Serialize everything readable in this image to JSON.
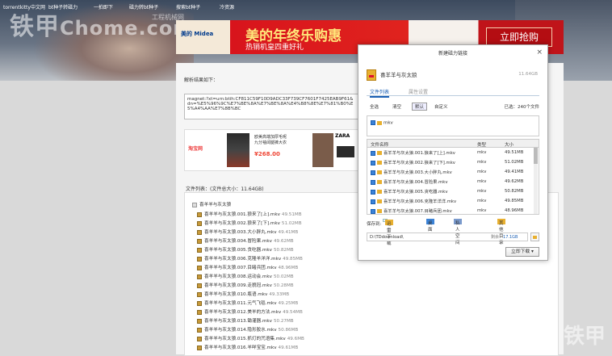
{
  "nav": [
    "torrentkitty中文网",
    "bt种子转磁力",
    "一拍即下",
    "磁力转bt种子",
    "搜索bt种子",
    "冷资源"
  ],
  "watermark": {
    "main": "铁甲",
    "url": "工程机械网",
    "site": "Chome.com",
    "bottom_right": "铁甲"
  },
  "banner": {
    "brand": "美的 Midea",
    "headline": "美的年终乐购惠",
    "subline": "热销机皇四重好礼",
    "cta": "立即抢购"
  },
  "page": {
    "result_label": "解析结果如下：",
    "magnet": "magnet:?xt=urn:btih:CF811C59F10D9ADC33F739CF7601F7425EAB9F61&dn=%E5%96%9C%E7%BE%8A%E7%BE%8A%E4%B8%8E%E7%81%B0%E5%A4%AA%E7%8B%BC",
    "file_list_label": "文件列表：(文件总大小：11.64GB)"
  },
  "ad": {
    "shop": "淘宝网",
    "desc": "欧美高端加厚毛呢\n九分袖阔腿裤大衣",
    "price": "¥268.00",
    "brand": "ZARA",
    "tag2": "cor"
  },
  "tree": {
    "root": "喜羊羊与灰太狼",
    "items": [
      {
        "name": "喜羊羊与灰太狼.001.狼来了[上].mkv",
        "size": "49.51MB"
      },
      {
        "name": "喜羊羊与灰太狼.002.狼来了[下].mkv",
        "size": "51.02MB"
      },
      {
        "name": "喜羊羊与灰太狼.003.大小胖丸.mkv",
        "size": "49.41MB"
      },
      {
        "name": "喜羊羊与灰太狼.004.冒险果.mkv",
        "size": "49.62MB"
      },
      {
        "name": "喜羊羊与灰太狼.005.贪吃器.mkv",
        "size": "50.82MB"
      },
      {
        "name": "喜羊羊与灰太狼.006.克隆羊洋洋.mkv",
        "size": "49.85MB"
      },
      {
        "name": "喜羊羊与灰太狼.007.目睹兵团.mkv",
        "size": "48.96MB"
      },
      {
        "name": "喜羊羊与灰太狼.008.运动会.mkv",
        "size": "50.02MB"
      },
      {
        "name": "喜羊羊与灰太狼.009.走貌冠.mkv",
        "size": "50.28MB"
      },
      {
        "name": "喜羊羊与灰太狼.010.瓶语.mkv",
        "size": "49.33MB"
      },
      {
        "name": "喜羊羊与灰太狼.011.元气飞毯.mkv",
        "size": "49.25MB"
      },
      {
        "name": "喜羊羊与灰太狼.012.美羊的方法.mkv",
        "size": "49.54MB"
      },
      {
        "name": "喜羊羊与灰太狼.013.锄灌器.mkv",
        "size": "50.27MB"
      },
      {
        "name": "喜羊羊与灰太狼.014.隐形胶水.mkv",
        "size": "50.86MB"
      },
      {
        "name": "喜羊羊与灰太狼.015.抓灯的咒语集.mkv",
        "size": "49.6MB"
      },
      {
        "name": "喜羊羊与灰太狼.016.羊咩宝宝.mkv",
        "size": "49.61MB"
      }
    ]
  },
  "dialog": {
    "title": "新建磁力链接",
    "close": "×",
    "file_name": "喜羊羊与灰太狼",
    "file_size": "11.64GB",
    "tabs": [
      "文件列表",
      "属性设置"
    ],
    "buttons": [
      "全选",
      "清空",
      "默认",
      "自定义"
    ],
    "selected_count": "已选：240个文件",
    "filter_item": "mkv",
    "columns": [
      "文件名称",
      "类型",
      "大小"
    ],
    "rows": [
      {
        "name": "喜羊羊与灰太狼.001.狼来了[上].mkv",
        "type": "mkv",
        "size": "49.51MB"
      },
      {
        "name": "喜羊羊与灰太狼.002.狼来了[下].mkv",
        "type": "mkv",
        "size": "51.02MB"
      },
      {
        "name": "喜羊羊与灰太狼.003.大小胖丸.mkv",
        "type": "mkv",
        "size": "49.41MB"
      },
      {
        "name": "喜羊羊与灰太狼.004.冒险果.mkv",
        "type": "mkv",
        "size": "49.62MB"
      },
      {
        "name": "喜羊羊与灰太狼.005.贪吃器.mkv",
        "type": "mkv",
        "size": "50.82MB"
      },
      {
        "name": "喜羊羊与灰太狼.006.克隆羊洋洋.mkv",
        "type": "mkv",
        "size": "49.85MB"
      },
      {
        "name": "喜羊羊与灰太狼.007.目睹兵团.mkv",
        "type": "mkv",
        "size": "48.96MB"
      }
    ],
    "save_label": "保存到:",
    "save_options": [
      "迅雷下载",
      "桌面",
      "私人空间",
      "其他目录"
    ],
    "path": "D:\\TDdownload\\",
    "free_label": "剩余：",
    "free_value": "17.1GB",
    "download_button": "立即下载 ▾"
  },
  "colors": {
    "accent": "#1a5fb4",
    "banner_red": "#d8141c",
    "price": "#e43333"
  }
}
